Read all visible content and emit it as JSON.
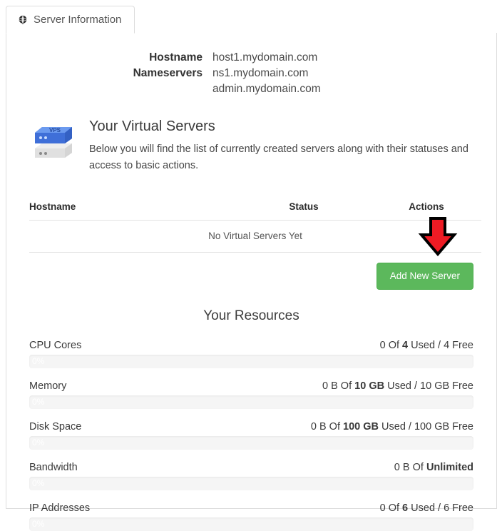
{
  "tab": {
    "icon": "globe-icon",
    "label": "Server Information"
  },
  "host_info": {
    "rows": [
      {
        "label": "Hostname",
        "value": "host1.mydomain.com"
      },
      {
        "label": "Nameservers",
        "value": "ns1.mydomain.com"
      },
      {
        "label": "",
        "value": "admin.mydomain.com"
      }
    ]
  },
  "intro": {
    "icon": "vps-server-icon",
    "icon_label": "VPS",
    "title": "Your Virtual Servers",
    "description": "Below you will find the list of currently created servers along with their statuses and access to basic actions."
  },
  "servers_table": {
    "columns": [
      "Hostname",
      "Status",
      "Actions"
    ],
    "empty_message": "No Virtual Servers Yet"
  },
  "actions": {
    "add_server_label": "Add New Server",
    "add_server_color": "#5cb85c",
    "annotation_arrow_color": "#ee1b24"
  },
  "resources": {
    "title": "Your Resources",
    "items": [
      {
        "name": "CPU Cores",
        "usage_prefix": "0 Of ",
        "usage_total": "4",
        "usage_suffix": " Used / 4 Free",
        "percent_label": "0%",
        "percent": 0
      },
      {
        "name": "Memory",
        "usage_prefix": "0 B Of ",
        "usage_total": "10 GB",
        "usage_suffix": " Used / 10 GB Free",
        "percent_label": "0%",
        "percent": 0
      },
      {
        "name": "Disk Space",
        "usage_prefix": "0 B Of ",
        "usage_total": "100 GB",
        "usage_suffix": " Used / 100 GB Free",
        "percent_label": "0%",
        "percent": 0
      },
      {
        "name": "Bandwidth",
        "usage_prefix": "0 B Of ",
        "usage_total": "Unlimited",
        "usage_suffix": "",
        "percent_label": "0%",
        "percent": 0
      },
      {
        "name": "IP Addresses",
        "usage_prefix": "0 Of ",
        "usage_total": "6",
        "usage_suffix": " Used / 6 Free",
        "percent_label": "0%",
        "percent": 0
      }
    ]
  }
}
